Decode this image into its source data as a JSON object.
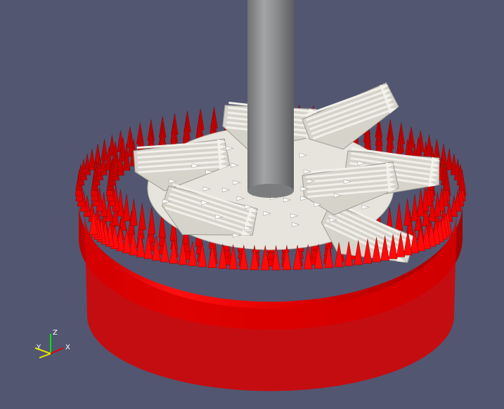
{
  "viewport": {
    "background": "#525671",
    "accent_red": "#ff0000",
    "impeller_color": "#e6e4dc",
    "shaft_color": "#8e8f90",
    "ring_rows": 3,
    "cones_per_row": 84,
    "blade_count": 7,
    "arrows_per_blade": 6
  },
  "orientation_axes": {
    "z_label": "Z",
    "y_label": "Y",
    "x_label": "X",
    "z_color": "#00e600",
    "y_color": "#e6e600",
    "x_color": "#e60000"
  }
}
